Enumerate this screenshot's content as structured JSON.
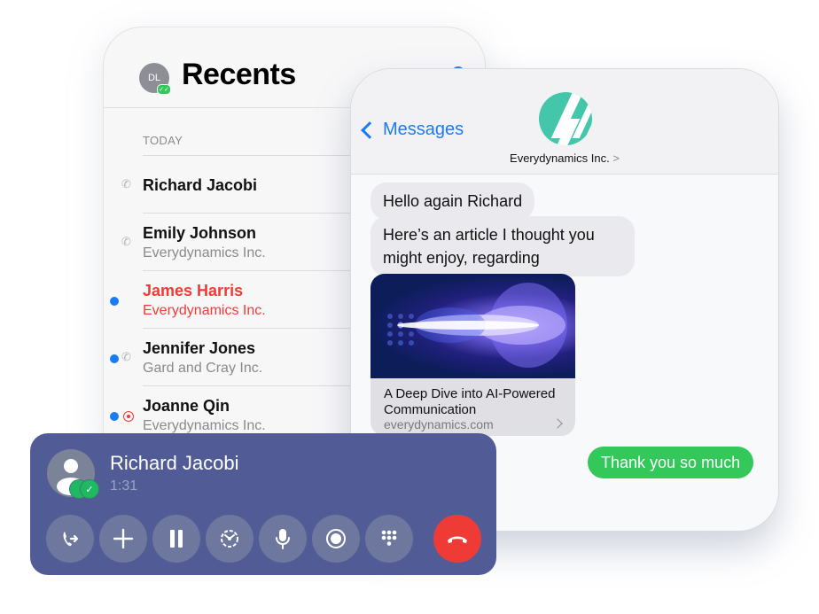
{
  "recents": {
    "title": "Recents",
    "avatar_initials": "DL",
    "section_label": "TODAY",
    "items": [
      {
        "name": "Richard Jacobi",
        "subtitle": "",
        "missed": false,
        "unread": false,
        "icon": "outgoing-call-icon"
      },
      {
        "name": "Emily Johnson",
        "subtitle": "Everydynamics Inc.",
        "missed": false,
        "unread": false,
        "icon": "outgoing-call-icon"
      },
      {
        "name": "James Harris",
        "subtitle": "Everydynamics Inc.",
        "missed": true,
        "unread": true,
        "icon": ""
      },
      {
        "name": "Jennifer Jones",
        "subtitle": "Gard and Cray Inc.",
        "missed": false,
        "unread": true,
        "icon": "outgoing-call-icon"
      },
      {
        "name": "Joanne Qin",
        "subtitle": "Everydynamics Inc.",
        "missed": false,
        "unread": true,
        "icon": "recording-icon"
      }
    ]
  },
  "messages": {
    "back_label": "Messages",
    "contact_name": "Everydynamics Inc.",
    "contact_chevron": ">",
    "incoming": [
      "Hello again Richard",
      "Here’s an article I thought you might enjoy, regarding"
    ],
    "link_card": {
      "title": "A Deep Dive into AI-Powered Communication",
      "url": "everydynamics.com"
    },
    "outgoing": [
      "Thank you so much"
    ]
  },
  "call": {
    "caller_name": "Richard Jacobi",
    "duration": "1:31",
    "buttons": [
      {
        "name": "transfer",
        "icon": "transfer-call-icon"
      },
      {
        "name": "add",
        "icon": "plus-icon"
      },
      {
        "name": "hold",
        "icon": "pause-icon"
      },
      {
        "name": "merge",
        "icon": "merge-icon"
      },
      {
        "name": "mute",
        "icon": "microphone-icon"
      },
      {
        "name": "record",
        "icon": "record-icon"
      },
      {
        "name": "keypad",
        "icon": "keypad-icon"
      },
      {
        "name": "end",
        "icon": "end-call-icon"
      }
    ]
  },
  "colors": {
    "accent_blue": "#1a7cf5",
    "missed_red": "#ef3b36",
    "sent_green": "#34c759",
    "call_bar": "#515c96",
    "logo_teal": "#43c6a9"
  }
}
